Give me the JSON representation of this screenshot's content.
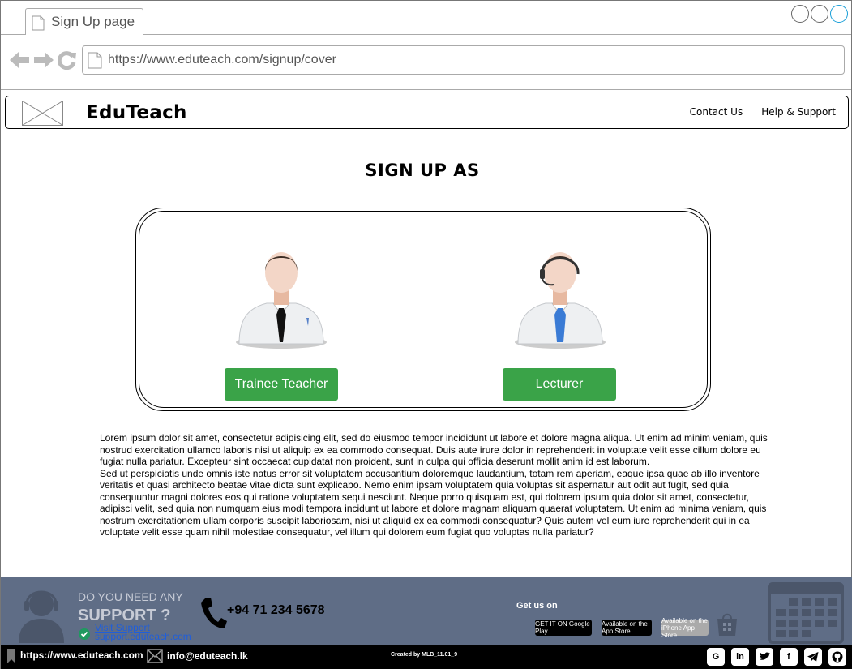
{
  "browser": {
    "tab_title": "Sign Up page",
    "url": "https://www.eduteach.com/signup/cover"
  },
  "header": {
    "brand": "EduTeach",
    "links": [
      "Contact Us",
      "Help & Support"
    ]
  },
  "main": {
    "heading": "SIGN UP AS",
    "roles": [
      {
        "label": "Trainee Teacher",
        "tie_color": "#111111"
      },
      {
        "label": "Lecturer",
        "tie_color": "#3a7bd5"
      }
    ],
    "paragraphs": [
      "Lorem ipsum dolor sit amet, consectetur adipisicing elit, sed do eiusmod tempor incididunt ut labore et dolore magna aliqua. Ut enim ad minim veniam, quis nostrud exercitation ullamco laboris nisi ut aliquip ex ea commodo consequat. Duis aute irure dolor in reprehenderit in voluptate velit esse cillum dolore eu fugiat nulla pariatur. Excepteur sint occaecat cupidatat non proident, sunt in culpa qui officia deserunt mollit anim id est laborum.",
      "Sed ut perspiciatis unde omnis iste natus error sit voluptatem accusantium doloremque laudantium, totam rem aperiam, eaque ipsa quae ab illo inventore veritatis et quasi architecto beatae vitae dicta sunt explicabo. Nemo enim ipsam voluptatem quia voluptas sit aspernatur aut odit aut fugit, sed quia consequuntur magni dolores eos qui ratione voluptatem sequi nesciunt. Neque porro quisquam est, qui dolorem ipsum quia dolor sit amet, consectetur, adipisci velit, sed quia non numquam eius modi tempora incidunt ut labore et dolore magnam aliquam quaerat voluptatem. Ut enim ad minima veniam, quis nostrum exercitationem ullam corporis suscipit laboriosam, nisi ut aliquid ex ea commodi consequatur? Quis autem vel eum iure reprehenderit qui in ea voluptate velit esse quam nihil molestiae consequatur, vel illum qui dolorem eum fugiat quo voluptas nulla pariatur?"
    ],
    "button_color": "#3aa348"
  },
  "footer": {
    "support_q1": "DO YOU NEED ANY",
    "support_q2": "SUPPORT ?",
    "visit_label": "Visit Support",
    "visit_url": "support.eduteach.com",
    "phone": "+94 71 234 5678",
    "get_us_on": "Get us on",
    "stores": [
      "GET IT ON Google Play",
      "Available on the App Store",
      "Available on the iPhone App Store"
    ],
    "bg_color": "#5f6d86"
  },
  "bottom_bar": {
    "url": "https://www.eduteach.com",
    "email": "info@eduteach.lk",
    "credit": "Created by MLB_11.01_9",
    "socials": [
      "google-icon",
      "linkedin-icon",
      "twitter-icon",
      "facebook-icon",
      "telegram-icon",
      "github-icon"
    ]
  }
}
